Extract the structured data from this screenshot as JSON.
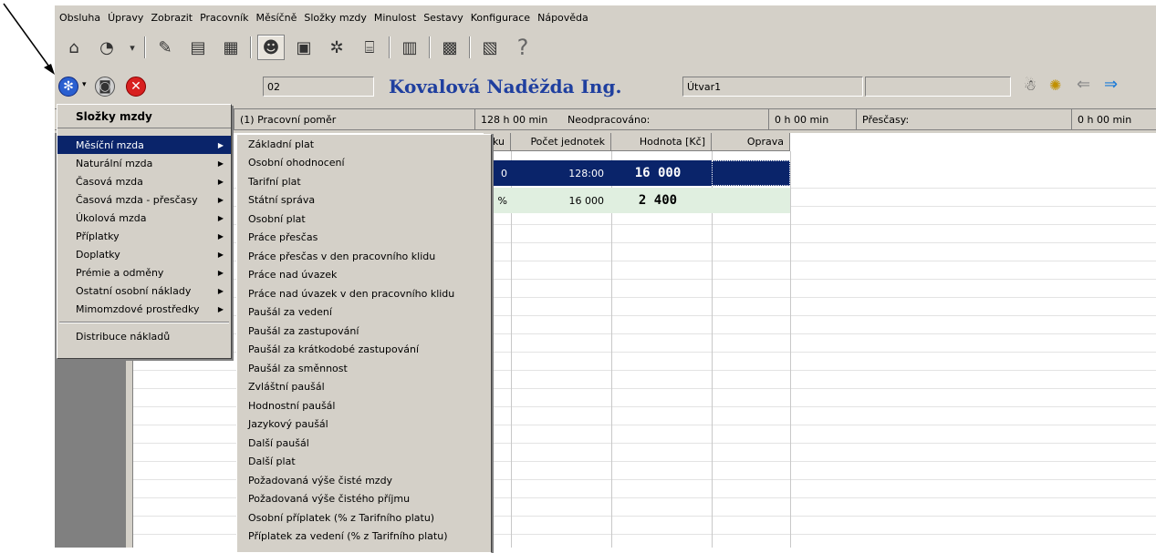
{
  "menubar": [
    "Obsluha",
    "Úpravy",
    "Zobrazit",
    "Pracovník",
    "Měsíčně",
    "Složky mzdy",
    "Minulost",
    "Sestavy",
    "Konfigurace",
    "Nápověda"
  ],
  "toolbar_icons": [
    "home-icon",
    "disk-icon",
    "dropdown-arrow-icon",
    "edit-doc-icon",
    "document-icon",
    "calendar-doc-icon",
    "person-card-icon",
    "document2-icon",
    "gears-icon",
    "bank-icon",
    "clipboard-icon",
    "calculator-icon",
    "report-icon",
    "help-icon"
  ],
  "person": {
    "code": "02",
    "name": "Kovalová Naděžda Ing.",
    "department": "Útvar1",
    "extra": ""
  },
  "info": {
    "employment": "(1) Pracovní poměr",
    "hours": "128 h 00 min",
    "unworked_label": "Neodpracováno:",
    "unworked_value": "0 h 00 min",
    "overtime_label": "Přesčasy:",
    "overtime_value": "0 h 00 min"
  },
  "grid": {
    "headers": [
      "ku",
      "Počet jednotek",
      "Hodnota [Kč]",
      "Oprava"
    ],
    "rows": [
      {
        "c0": "0",
        "units": "128:00",
        "value": "16 000",
        "fix": ""
      },
      {
        "c0": "%",
        "units": "16 000",
        "value": "2 400",
        "fix": ""
      }
    ]
  },
  "menu1": {
    "title": "Složky mzdy",
    "items": [
      "Měsíční mzda",
      "Naturální mzda",
      "Časová mzda",
      "Časová mzda - přesčasy",
      "Úkolová mzda",
      "Příplatky",
      "Doplatky",
      "Prémie a odměny",
      "Ostatní osobní náklady",
      "Mimomzdové prostředky"
    ],
    "extra": "Distribuce nákladů"
  },
  "menu2": {
    "items": [
      "Základní plat",
      "Osobní ohodnocení",
      "Tarifní plat",
      "Státní správa",
      "Osobní plat",
      "Práce přesčas",
      "Práce přesčas v den pracovního klidu",
      "Práce nad úvazek",
      "Práce nad úvazek v den pracovního klidu",
      "Paušál za vedení",
      "Paušál za zastupování",
      "Paušál za krátkodobé zastupování",
      "Paušál za směnnost",
      "Zvláštní paušál",
      "Hodnostní paušál",
      "Jazykový paušál",
      "Další paušál",
      "Další plat",
      "Požadovaná výše čisté mzdy",
      "Požadovaná výše čistého příjmu",
      "Osobní příplatek (% z Tarifního platu)",
      "Příplatek za vedení (% z Tarifního platu)"
    ]
  }
}
